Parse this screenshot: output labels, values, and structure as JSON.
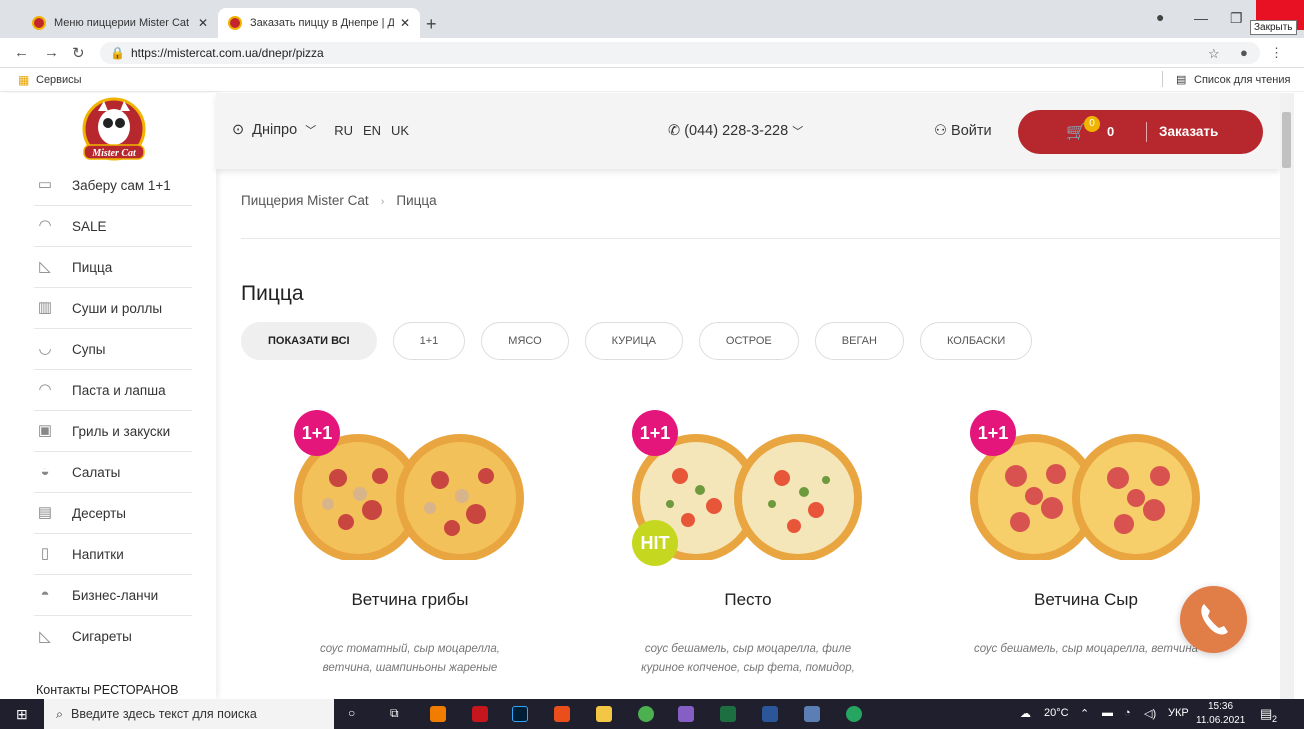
{
  "browser": {
    "tabs": [
      {
        "title": "Меню пиццерии Mister Cat"
      },
      {
        "title": "Заказать пиццу в Днепре | Дост"
      }
    ],
    "new_tab": "+",
    "tooltip": "Закрыть",
    "url_host": "https://mistercat.com.ua",
    "url_path": "/dnepr/pizza",
    "bookmarks_apps": "Сервисы",
    "reading_list": "Список для чтения"
  },
  "sidebar": {
    "logo_text": "Mister Cat",
    "items": [
      {
        "label": "Заберу сам 1+1",
        "icon": "box-icon"
      },
      {
        "label": "SALE",
        "icon": "tag-icon"
      },
      {
        "label": "Пицца",
        "icon": "pizza-icon"
      },
      {
        "label": "Суши и роллы",
        "icon": "sushi-icon"
      },
      {
        "label": "Супы",
        "icon": "soup-icon"
      },
      {
        "label": "Паста и лапша",
        "icon": "pasta-icon"
      },
      {
        "label": "Гриль и закуски",
        "icon": "grill-icon"
      },
      {
        "label": "Салаты",
        "icon": "salad-icon"
      },
      {
        "label": "Десерты",
        "icon": "cake-icon"
      },
      {
        "label": "Напитки",
        "icon": "bottle-icon"
      },
      {
        "label": "Бизнес-ланчи",
        "icon": "lunch-icon"
      },
      {
        "label": "Сигареты",
        "icon": "cigarette-icon"
      }
    ],
    "contacts": "Контакты РЕСТОРАНОВ"
  },
  "header": {
    "city": "Дніпро",
    "langs": [
      "RU",
      "EN",
      "UK"
    ],
    "phone": "(044) 228-3-228",
    "login": "Войти",
    "cart_badge": "0",
    "cart_count": "0",
    "order_label": "Заказать"
  },
  "main": {
    "breadcrumb": [
      "Пиццерия Mister Cat",
      "Пицца"
    ],
    "breadcrumb_sep": "›",
    "title": "Пицца",
    "filters": [
      "ПОКАЗАТИ ВСІ",
      "1+1",
      "МЯСО",
      "КУРИЦА",
      "ОСТРОЕ",
      "ВЕГАН",
      "КОЛБАСКИ"
    ],
    "products": [
      {
        "name": "Ветчина грибы",
        "badge": "1+1",
        "hit": "",
        "desc1": "соус томатный, сыр моцарелла,",
        "desc2": "ветчина, шампиньоны жареные"
      },
      {
        "name": "Песто",
        "badge": "1+1",
        "hit": "HIT",
        "desc1": "соус бешамель, сыр моцарелла, филе",
        "desc2": "куриное копченое, сыр фета, помидор,"
      },
      {
        "name": "Ветчина Сыр",
        "badge": "1+1",
        "hit": "",
        "desc1": "соус бешамель, сыр моцарелла, ветчина",
        "desc2": ""
      }
    ]
  },
  "taskbar": {
    "search_placeholder": "Введите здесь текст для поиска",
    "weather": "20°C",
    "lang": "УКР",
    "time": "15:36",
    "date": "11.06.2021",
    "notif_count": "2"
  },
  "colors": {
    "brand_red": "#b7282e",
    "badge_pink": "#e4167c",
    "hit_green": "#c6d720",
    "call_orange": "#e17d47"
  }
}
